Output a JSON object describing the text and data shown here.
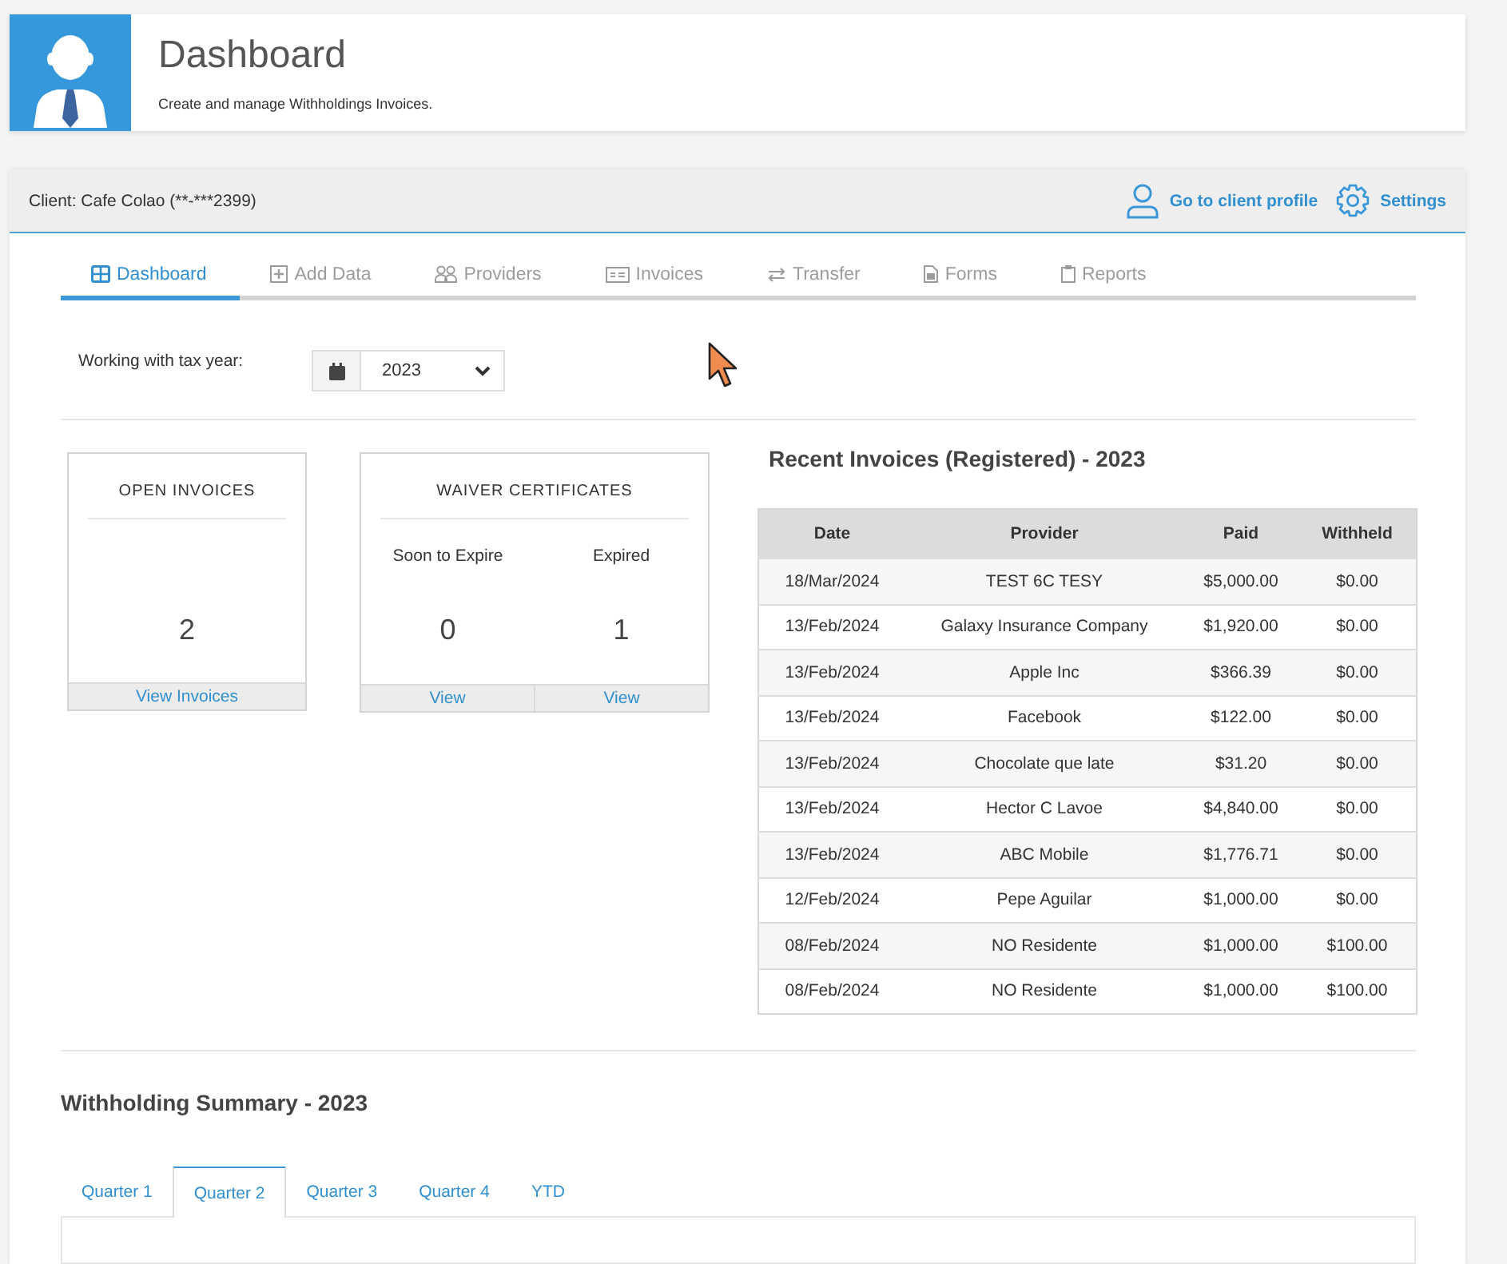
{
  "header": {
    "title": "Dashboard",
    "subtitle": "Create and manage Withholdings Invoices."
  },
  "client_bar": {
    "client": "Client: Cafe Colao (**-***2399)",
    "links": [
      {
        "kind": "profile",
        "label": "Go to client profile"
      },
      {
        "kind": "settings",
        "label": "Settings"
      }
    ]
  },
  "tabs": [
    {
      "kind": "dashboard",
      "label": "Dashboard",
      "selected": true
    },
    {
      "kind": "add",
      "label": "Add Data",
      "selected": false
    },
    {
      "kind": "providers",
      "label": "Providers",
      "selected": false
    },
    {
      "kind": "invoices",
      "label": "Invoices",
      "selected": false
    },
    {
      "kind": "transfer",
      "label": "Transfer",
      "selected": false
    },
    {
      "kind": "forms",
      "label": "Forms",
      "selected": false
    },
    {
      "kind": "reports",
      "label": "Reports",
      "selected": false
    }
  ],
  "tax_year": {
    "label": "Working with tax year:",
    "value": "2023"
  },
  "open_invoices": {
    "title": "OPEN INVOICES",
    "count": "2",
    "link": "View Invoices"
  },
  "waiver_certificates": {
    "title": "WAIVER CERTIFICATES",
    "columns": [
      {
        "label": "Soon to Expire",
        "count": "0",
        "link": "View"
      },
      {
        "label": "Expired",
        "count": "1",
        "link": "View"
      }
    ]
  },
  "recent_invoices": {
    "title": "Recent Invoices (Registered) - 2023",
    "columns": [
      "Date",
      "Provider",
      "Paid",
      "Withheld"
    ],
    "rows": [
      [
        "18/Mar/2024",
        "TEST 6C TESY",
        "$5,000.00",
        "$0.00"
      ],
      [
        "13/Feb/2024",
        "Galaxy Insurance Company",
        "$1,920.00",
        "$0.00"
      ],
      [
        "13/Feb/2024",
        "Apple Inc",
        "$366.39",
        "$0.00"
      ],
      [
        "13/Feb/2024",
        "Facebook",
        "$122.00",
        "$0.00"
      ],
      [
        "13/Feb/2024",
        "Chocolate que late",
        "$31.20",
        "$0.00"
      ],
      [
        "13/Feb/2024",
        "Hector C Lavoe",
        "$4,840.00",
        "$0.00"
      ],
      [
        "13/Feb/2024",
        "ABC Mobile",
        "$1,776.71",
        "$0.00"
      ],
      [
        "12/Feb/2024",
        "Pepe Aguilar",
        "$1,000.00",
        "$0.00"
      ],
      [
        "08/Feb/2024",
        "NO Residente",
        "$1,000.00",
        "$100.00"
      ],
      [
        "08/Feb/2024",
        "NO Residente",
        "$1,000.00",
        "$100.00"
      ]
    ]
  },
  "withholding_summary": {
    "title": "Withholding Summary - 2023",
    "tabs": [
      {
        "label": "Quarter 1",
        "selected": false
      },
      {
        "label": "Quarter 2",
        "selected": true
      },
      {
        "label": "Quarter 3",
        "selected": false
      },
      {
        "label": "Quarter 4",
        "selected": false
      },
      {
        "label": "YTD",
        "selected": false
      }
    ]
  }
}
